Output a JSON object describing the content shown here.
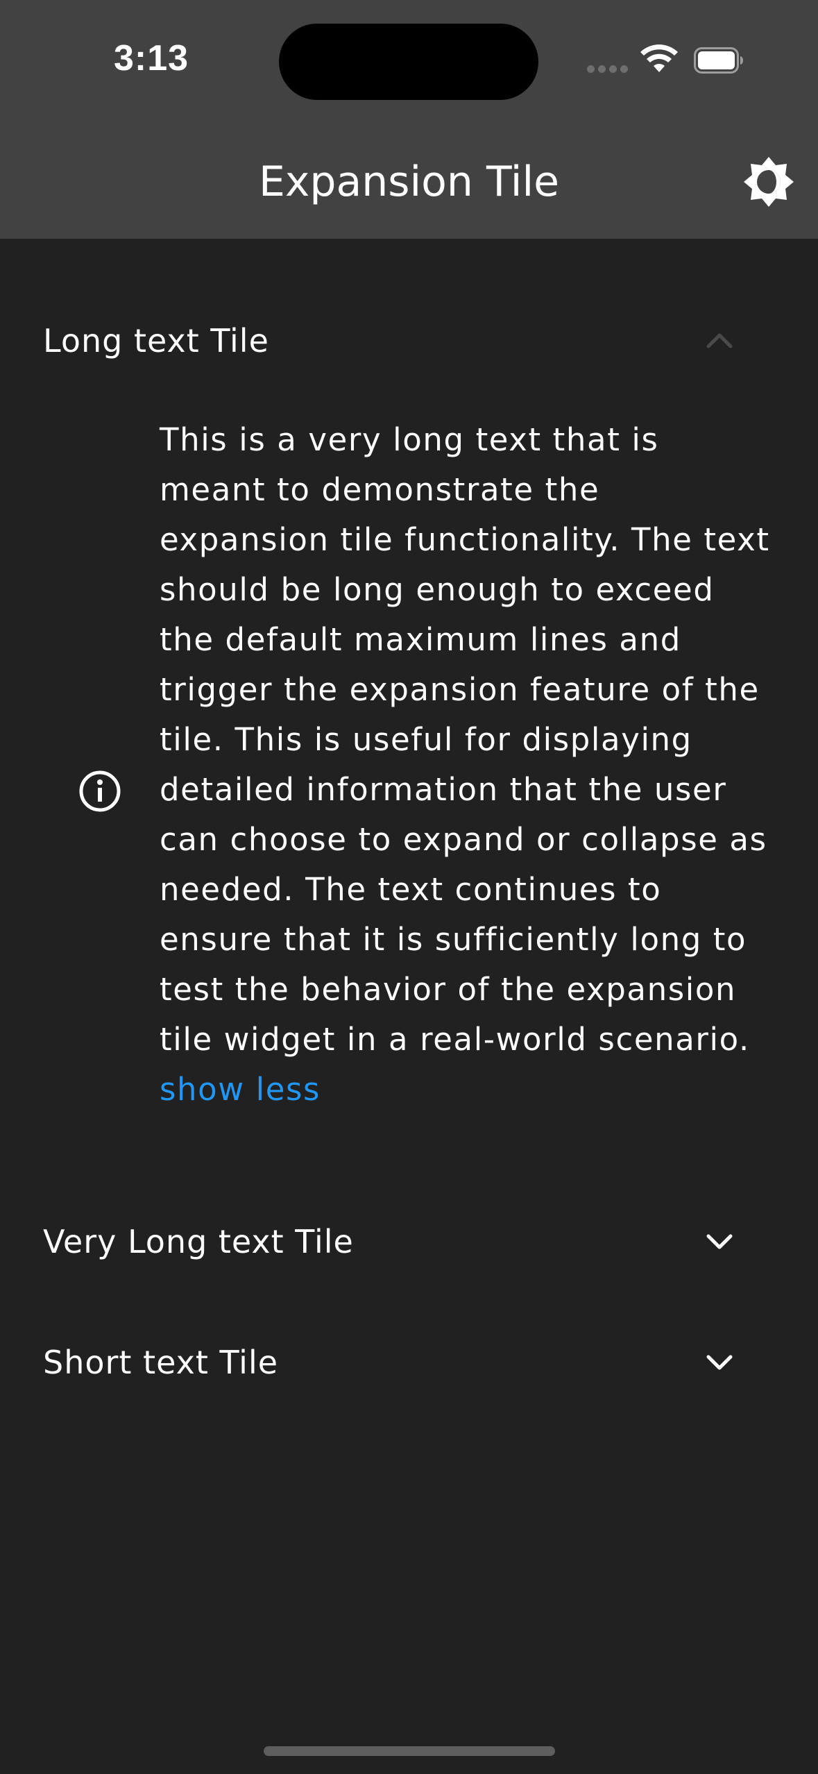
{
  "status_bar": {
    "time": "3:13"
  },
  "app_bar": {
    "title": "Expansion Tile",
    "theme_toggle_icon": "brightness-icon"
  },
  "tiles": [
    {
      "title": "Long text Tile",
      "expanded": true,
      "leading_icon": "info-icon",
      "text": "This is a very long text that is meant to demonstrate the expansion tile functionality. The text should be long enough to exceed the default maximum lines and trigger the expansion feature of the tile. This is useful for displaying detailed information that the user can choose to expand or collapse as needed. The text continues to ensure that it is sufficiently long to test the behavior of the expansion tile widget in a real-world scenario.",
      "toggle_label": "show less"
    },
    {
      "title": "Very Long text Tile",
      "expanded": false
    },
    {
      "title": "Short text Tile",
      "expanded": false
    }
  ],
  "colors": {
    "background": "#212121",
    "app_bar": "#424242",
    "link": "#2196f3",
    "text": "#ffffff"
  }
}
